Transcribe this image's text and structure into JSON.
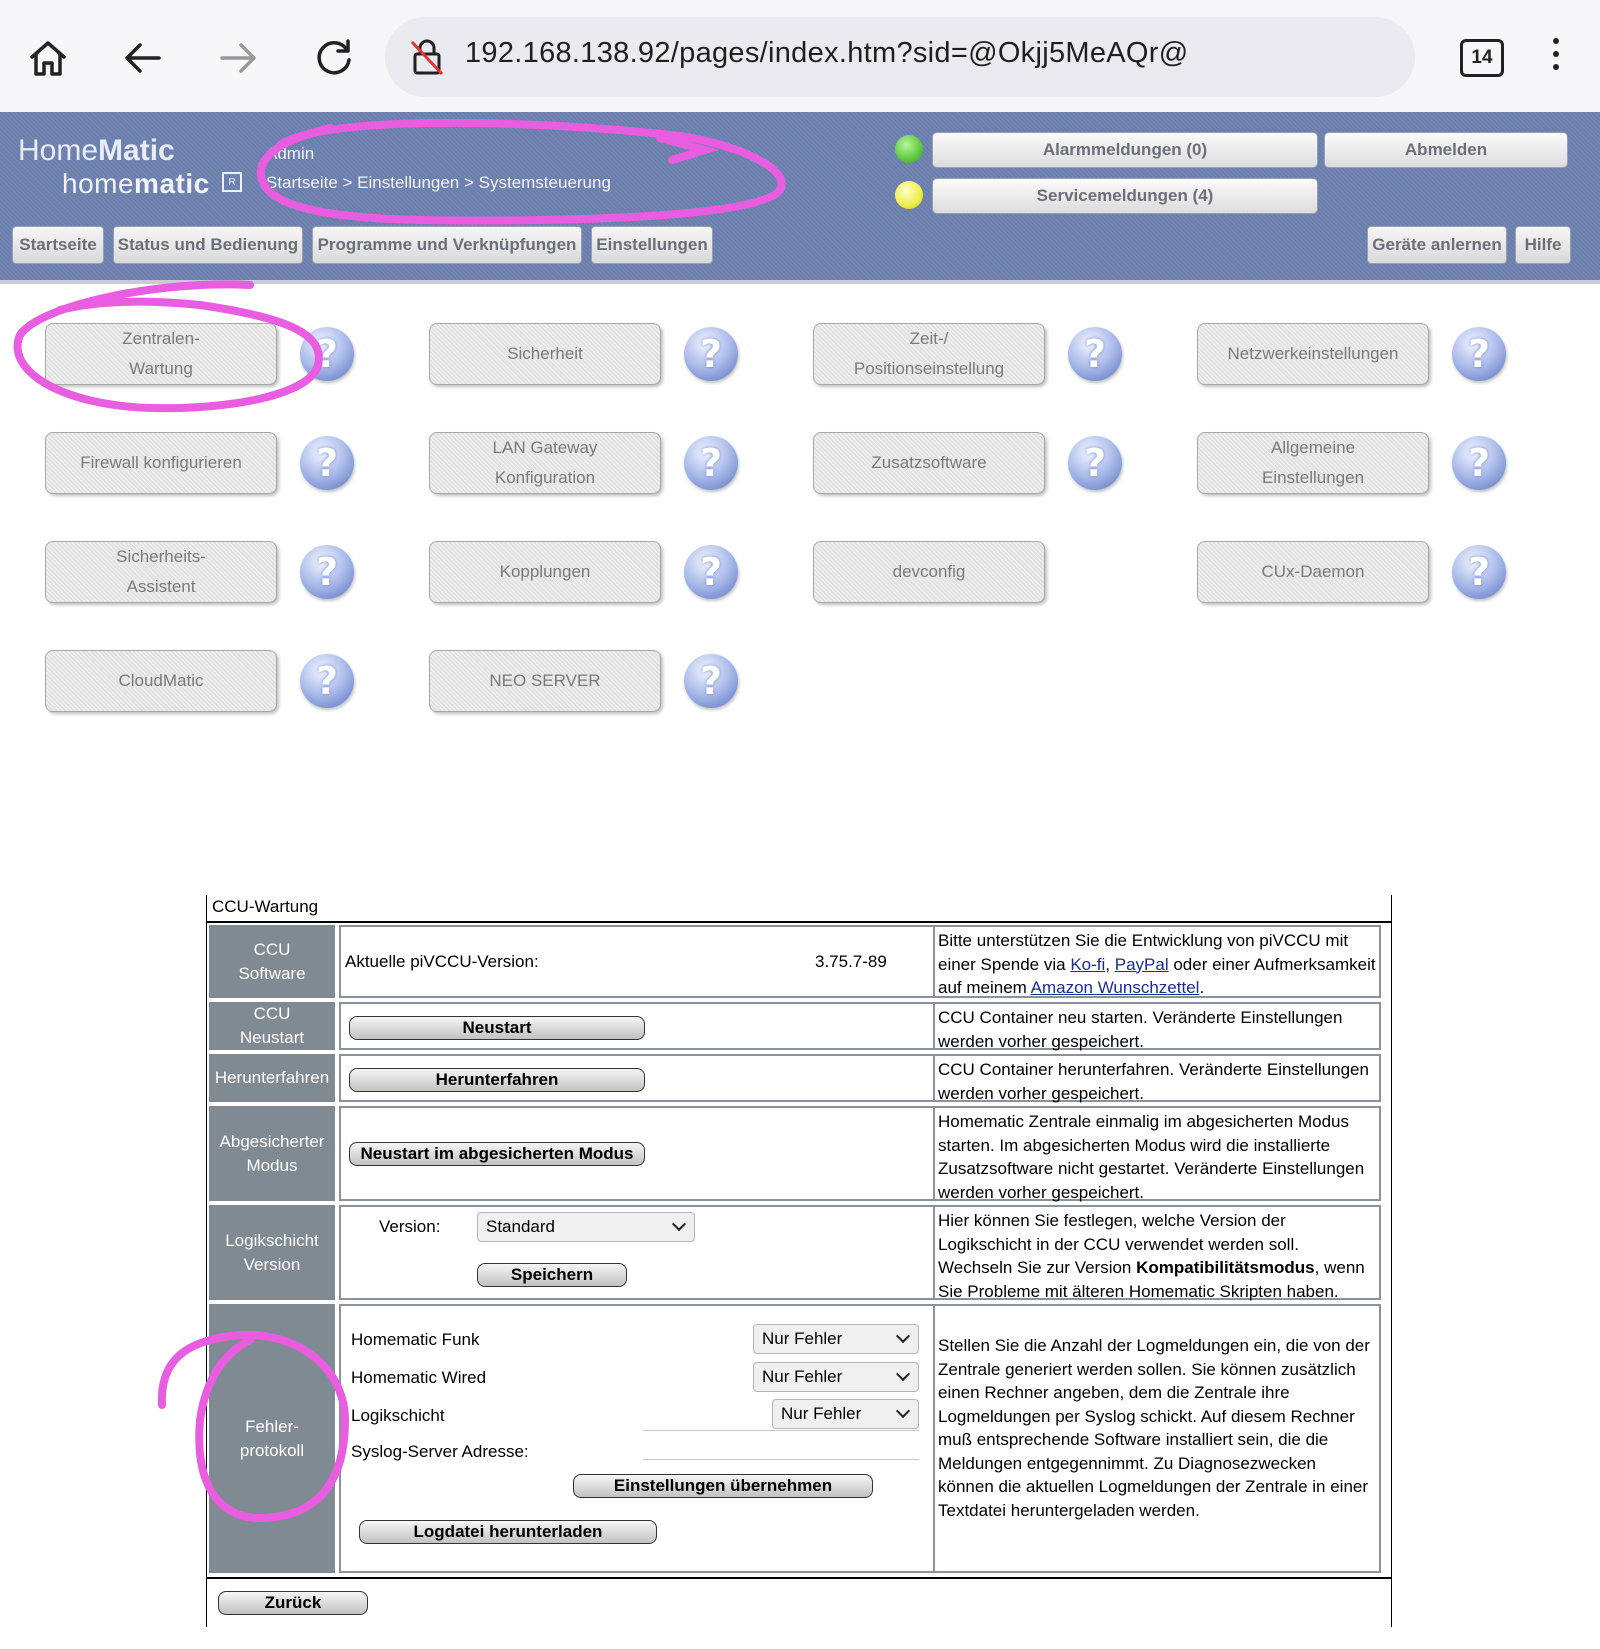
{
  "browser": {
    "url": "192.168.138.92/pages/index.htm?sid=@Okjj5MeAQr@",
    "tab_count": "14"
  },
  "header": {
    "logo_top_a": "Home",
    "logo_top_b": "Matic",
    "logo_bottom_a": "home",
    "logo_bottom_b": "matic",
    "user": "Admin",
    "breadcrumb": "Startseite > Einstellungen > Systemsteuerung",
    "alarm_button": "Alarmmeldungen (0)",
    "service_button": "Servicemeldungen (4)",
    "logout_button": "Abmelden",
    "nav": {
      "home": "Startseite",
      "status": "Status und Bedienung",
      "programs": "Programme und Verknüpfungen",
      "settings": "Einstellungen",
      "teach": "Geräte anlernen",
      "help": "Hilfe"
    }
  },
  "tiles": {
    "t1a": "Zentralen-",
    "t1b": "Wartung",
    "t2": "Sicherheit",
    "t3a": "Zeit-/",
    "t3b": "Positionseinstellung",
    "t4": "Netzwerkeinstellungen",
    "t5": "Firewall konfigurieren",
    "t6a": "LAN Gateway",
    "t6b": "Konfiguration",
    "t7": "Zusatzsoftware",
    "t8a": "Allgemeine",
    "t8b": "Einstellungen",
    "t9a": "Sicherheits-",
    "t9b": "Assistent",
    "t10": "Kopplungen",
    "t11": "devconfig",
    "t12": "CUx-Daemon",
    "t13": "CloudMatic",
    "t14": "NEO SERVER",
    "help_glyph": "?"
  },
  "wartung": {
    "title": "CCU-Wartung",
    "rows": {
      "software": {
        "label_a": "CCU",
        "label_b": "Software",
        "version_label": "Aktuelle piVCCU-Version:",
        "version_value": "3.75.7-89",
        "desc_a": "Bitte unterstützen Sie die Entwicklung von piVCCU mit",
        "desc_b": "einer Spende via ",
        "link_kofi": "Ko-fi",
        "comma": ", ",
        "link_paypal": "PayPal",
        "desc_c": " oder einer",
        "desc_d": "Aufmerksamkeit auf meinem ",
        "link_amazon": "Amazon Wunschzettel",
        "desc_e": "."
      },
      "restart": {
        "label_a": "CCU",
        "label_b": "Neustart",
        "button": "Neustart",
        "desc": "CCU Container neu starten. Veränderte Einstellungen werden vorher gespeichert."
      },
      "shutdown": {
        "label": "Herunterfahren",
        "button": "Herunterfahren",
        "desc": "CCU Container herunterfahren. Veränderte Einstellungen werden vorher gespeichert."
      },
      "safemode": {
        "label_a": "Abgesicherter",
        "label_b": "Modus",
        "button": "Neustart im abgesicherten Modus",
        "desc": "Homematic Zentrale einmalig im abgesicherten Modus starten. Im abgesicherten Modus wird die installierte Zusatzsoftware nicht gestartet. Veränderte Einstellungen werden vorher gespeichert."
      },
      "logic": {
        "label_a": "Logikschicht",
        "label_b": "Version",
        "version_label": "Version:",
        "version_value": "Standard",
        "save_button": "Speichern",
        "desc_a": "Hier können Sie festlegen, welche Version der Logikschicht in der CCU verwendet werden soll. Wechseln Sie zur Version ",
        "desc_bold": "Kompatibilitätsmodus",
        "desc_b": ", wenn Sie Probleme mit älteren Homematic Skripten haben."
      },
      "errorlog": {
        "label_a": "Fehler-",
        "label_b": "protokoll",
        "funk_label": "Homematic Funk",
        "funk_value": "Nur Fehler",
        "wired_label": "Homematic Wired",
        "wired_value": "Nur Fehler",
        "logic_label": "Logikschicht",
        "logic_value": "Nur Fehler",
        "syslog_label": "Syslog-Server Adresse:",
        "syslog_value": "",
        "apply_button": "Einstellungen übernehmen",
        "download_button": "Logdatei herunterladen",
        "desc": "Stellen Sie die Anzahl der Logmeldungen ein, die von der Zentrale generiert werden sollen. Sie können zusätzlich einen Rechner angeben, dem die Zentrale ihre Logmeldungen per Syslog schickt. Auf diesem Rechner muß entsprechende Software installiert sein, die die Meldungen entgegennimmt. Zu Diagnosezwecken können die aktuellen Logmeldungen der Zentrale in einer Textdatei heruntergeladen werden."
      }
    },
    "back_button": "Zurück"
  },
  "colors": {
    "header_bg": "#6b7fad",
    "label_bg": "#7f8a93",
    "annotation": "#e95ee0"
  }
}
